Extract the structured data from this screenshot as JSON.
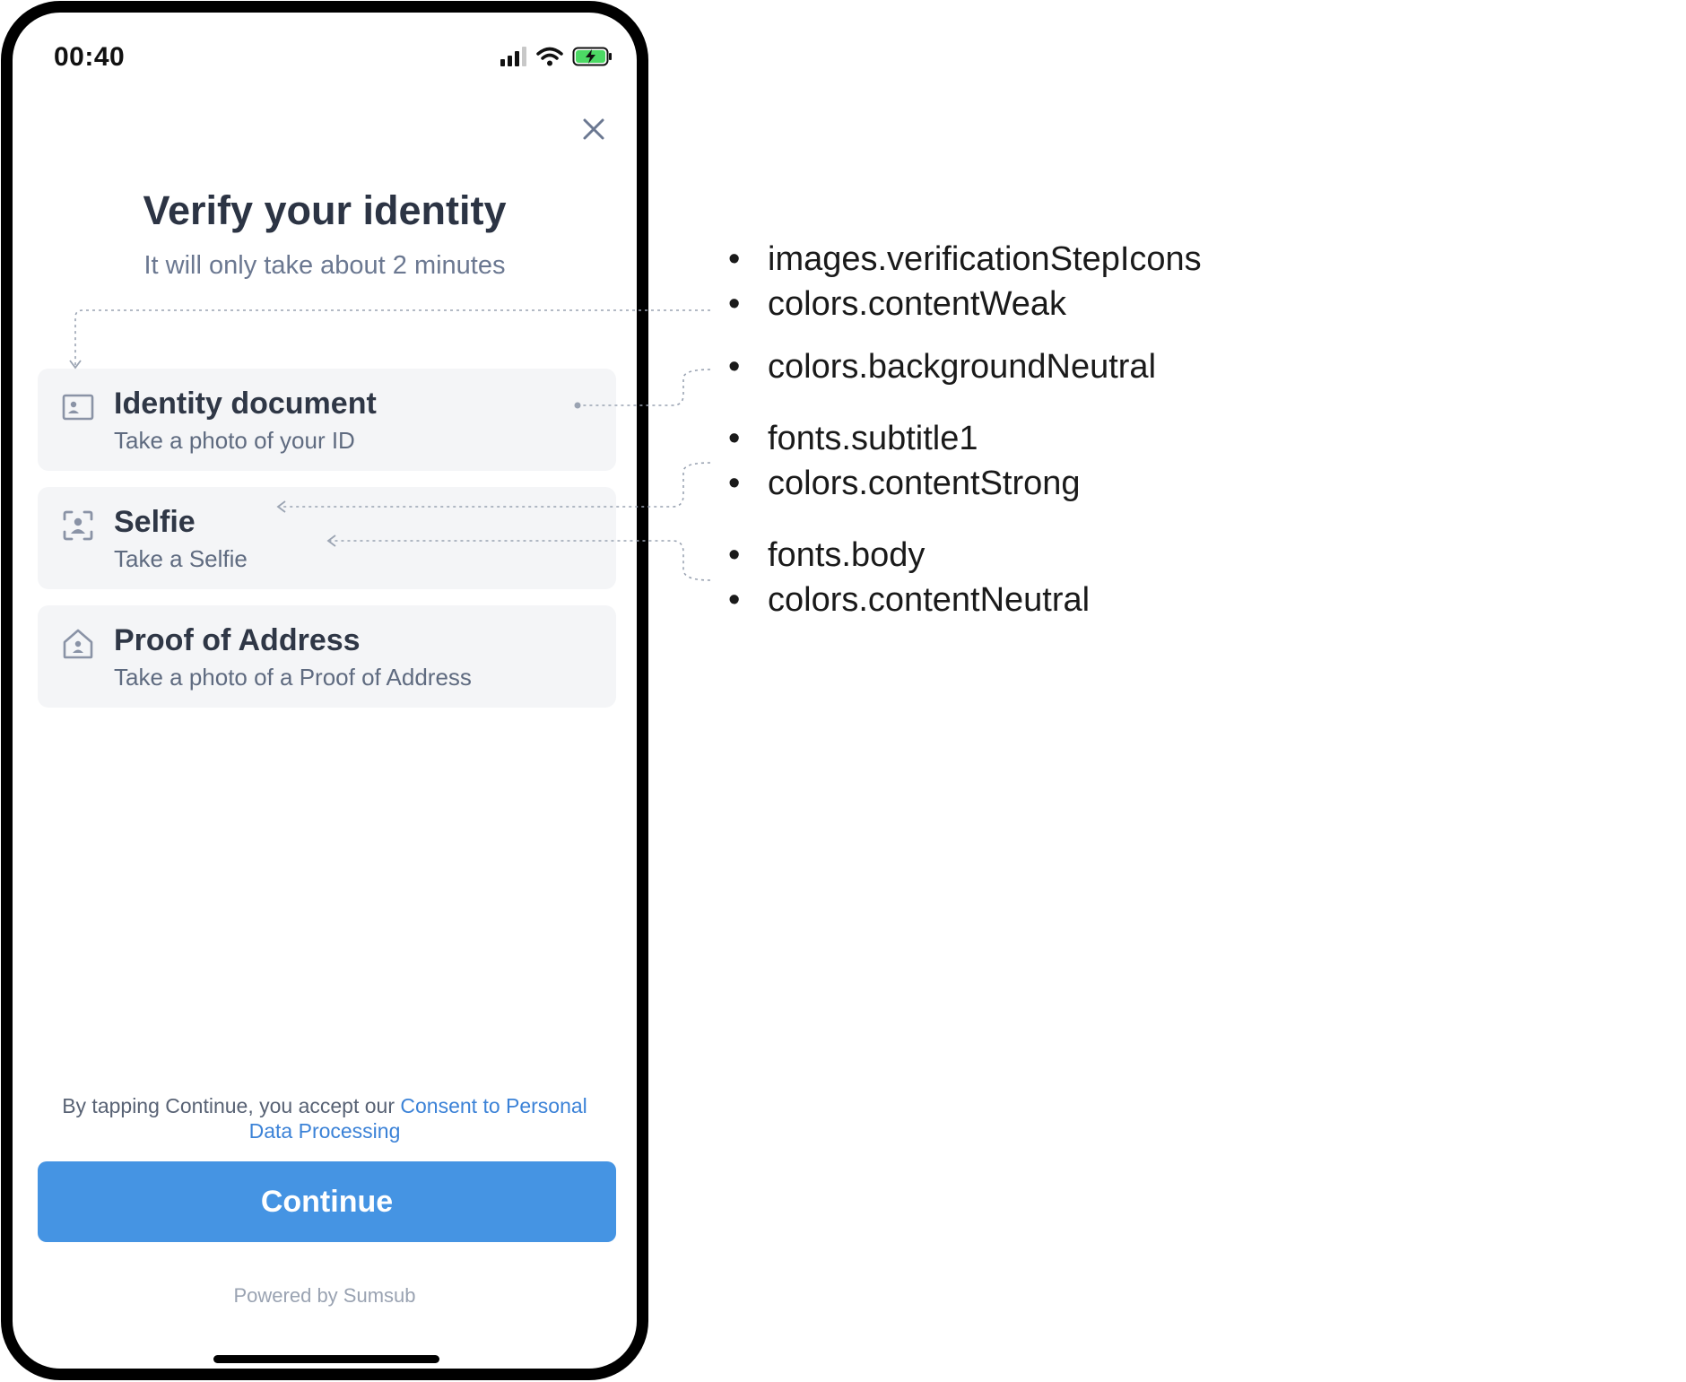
{
  "status_bar": {
    "time": "00:40"
  },
  "header": {
    "title": "Verify your identity",
    "subtitle": "It will only take about 2 minutes"
  },
  "steps": [
    {
      "title": "Identity document",
      "subtitle": "Take a photo of your ID",
      "icon": "id-card-icon"
    },
    {
      "title": "Selfie",
      "subtitle": "Take a Selfie",
      "icon": "face-scan-icon"
    },
    {
      "title": "Proof of Address",
      "subtitle": "Take a photo of a Proof of Address",
      "icon": "house-icon"
    }
  ],
  "consent": {
    "prefix": "By tapping Continue, you accept our ",
    "link": "Consent to Personal Data Processing"
  },
  "continue_label": "Continue",
  "powered_by": "Powered by Sumsub",
  "annotations": [
    "images.verificationStepIcons",
    "colors.contentWeak",
    "colors.backgroundNeutral",
    "fonts.subtitle1",
    "colors.contentStrong",
    "fonts.body",
    "colors.contentNeutral"
  ],
  "colors": {
    "accent": "#4594e3",
    "link": "#3b82d7",
    "content_strong": "#2f3746",
    "content_neutral": "#5f6b80",
    "content_weak": "#8a93a6",
    "background_neutral": "#f4f5f7"
  }
}
